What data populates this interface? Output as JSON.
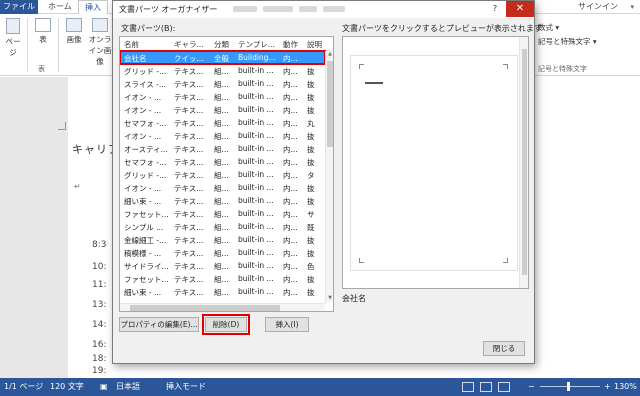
{
  "ribbon": {
    "tabs": [
      "ファイル",
      "ホーム",
      "挿入"
    ],
    "signin": "サインイン",
    "buttons": [
      "ページ",
      "表",
      "画像",
      "オンライン画像"
    ],
    "group_table": "表",
    "right_items": [
      "数式 ▾",
      "記号と特殊文字 ▾",
      "記号と特殊文字"
    ]
  },
  "document": {
    "title": "キャリア",
    "times": [
      "8:3",
      "10:",
      "11:",
      "13:",
      "14:",
      "16:",
      "18:",
      "19:"
    ]
  },
  "dialog": {
    "title": "文書パーツ オーガナイザー",
    "list_label": "文書パーツ(B):",
    "columns": [
      "名前",
      "ギャラ...",
      "分類",
      "テンプレ...",
      "動作",
      "説明"
    ],
    "rows": [
      [
        "会社名",
        "クイッ...",
        "全般",
        "Building...",
        "内...",
        ""
      ],
      [
        "グリッド -...",
        "テキス...",
        "組...",
        "built-in ...",
        "内...",
        "抜"
      ],
      [
        "スライス -...",
        "テキス...",
        "組...",
        "built-in ...",
        "内...",
        "抜"
      ],
      [
        "イオン - ...",
        "テキス...",
        "組...",
        "built-in ...",
        "内...",
        "抜"
      ],
      [
        "イオン - ...",
        "テキス...",
        "組...",
        "built-in ...",
        "内...",
        "抜"
      ],
      [
        "セマフォ -...",
        "テキス...",
        "組...",
        "built-in ...",
        "内...",
        "丸"
      ],
      [
        "イオン - ...",
        "テキス...",
        "組...",
        "built-in ...",
        "内...",
        "抜"
      ],
      [
        "オースティ...",
        "テキス...",
        "組...",
        "built-in ...",
        "内...",
        "抜"
      ],
      [
        "セマフォ -...",
        "テキス...",
        "組...",
        "built-in ...",
        "内...",
        "抜"
      ],
      [
        "グリッド -...",
        "テキス...",
        "組...",
        "built-in ...",
        "内...",
        "タ"
      ],
      [
        "イオン - ...",
        "テキス...",
        "組...",
        "built-in ...",
        "内...",
        "抜"
      ],
      [
        "細い束 - ...",
        "テキス...",
        "組...",
        "built-in ...",
        "内...",
        "抜"
      ],
      [
        "ファセット...",
        "テキス...",
        "組...",
        "built-in ...",
        "内...",
        "サ"
      ],
      [
        "シンプル ...",
        "テキス...",
        "組...",
        "built-in ...",
        "内...",
        "既"
      ],
      [
        "金線細工 -...",
        "テキス...",
        "組...",
        "built-in ...",
        "内...",
        "抜"
      ],
      [
        "稿模様 - ...",
        "テキス...",
        "組...",
        "built-in ...",
        "内...",
        "抜"
      ],
      [
        "サイドライ...",
        "テキス...",
        "組...",
        "built-in ...",
        "内...",
        "色"
      ],
      [
        "ファセット...",
        "テキス...",
        "組...",
        "built-in ...",
        "内...",
        "抜"
      ],
      [
        "細い束 - ...",
        "テキス...",
        "組...",
        "built-in ...",
        "内...",
        "抜"
      ]
    ],
    "preview_label": "文書パーツをクリックするとプレビューが表示されます",
    "preview_name": "会社名",
    "buttons": {
      "edit": "プロパティの編集(E)...",
      "delete": "削除(D)",
      "insert": "挿入(I)",
      "close": "閉じる"
    },
    "close_glyph": "✕",
    "help_glyph": "?"
  },
  "status": {
    "page": "1/1 ページ",
    "words": "120 文字",
    "lang": "日本語",
    "mode": "挿入モード",
    "zoom": "130%",
    "zoom_minus": "−",
    "zoom_plus": "+"
  },
  "colors": {
    "word_blue": "#2b579a",
    "selection": "#3399ff",
    "highlight_red": "#e00000",
    "close_red": "#c42b1c"
  }
}
